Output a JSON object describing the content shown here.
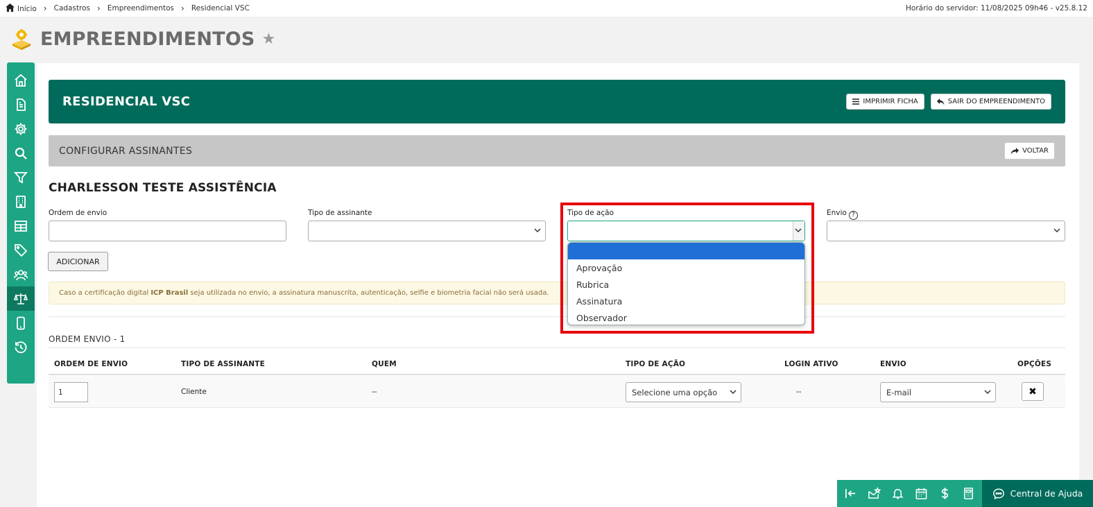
{
  "breadcrumb": {
    "items": [
      "Início",
      "Cadastros",
      "Empreendimentos",
      "Residencial VSC"
    ]
  },
  "server_info": "Horário do servidor: 11/08/2025 09h46 - v25.8.12",
  "page": {
    "title": "EMPREENDIMENTOS"
  },
  "sidebar": {
    "icons": [
      "home-icon",
      "document-icon",
      "gear-icon",
      "search-icon",
      "filter-icon",
      "building-icon",
      "table-icon",
      "tag-icon",
      "users-icon",
      "scale-icon",
      "phone-icon",
      "history-icon"
    ],
    "active_index": 9
  },
  "banner": {
    "title": "RESIDENCIAL VSC",
    "print_label": "IMPRIMIR FICHA",
    "exit_label": "SAIR DO EMPREENDIMENTO"
  },
  "subbar": {
    "title": "CONFIGURAR ASSINANTES",
    "back_label": "VOLTAR"
  },
  "section": {
    "title": "CHARLESSON TESTE ASSISTÊNCIA"
  },
  "form": {
    "ordem_label": "Ordem de envio",
    "tipo_assinante_label": "Tipo de assinante",
    "tipo_acao_label": "Tipo de ação",
    "envio_label": "Envio",
    "add_label": "ADICIONAR"
  },
  "notice": {
    "before": "Caso a certificação digital",
    "bold": "ICP Brasil",
    "after": "seja utilizada no envio, a assinatura manuscrita, autenticação, selfie e biometria facial não será usada."
  },
  "dropdown": {
    "options": [
      "",
      "Aprovação",
      "Rubrica",
      "Assinatura",
      "Observador"
    ],
    "selected_index": 0
  },
  "order": {
    "title": "ORDEM ENVIO - 1",
    "headers": [
      "ORDEM DE ENVIO",
      "TIPO DE ASSINANTE",
      "QUEM",
      "TIPO DE AÇÃO",
      "LOGIN ATIVO",
      "ENVIO",
      "OPÇÕES"
    ],
    "row": {
      "ordem": "1",
      "tipo_assinante": "Cliente",
      "quem": "--",
      "tipo_acao": "Selecione uma opção",
      "login_ativo": "--",
      "envio": "E-mail",
      "delete_glyph": "✖"
    }
  },
  "footer": {
    "help_label": "Central de Ajuda"
  },
  "colors": {
    "brand_dark": "#006b5a",
    "brand_light": "#1ea583",
    "highlight": "#e8000b",
    "selected_option": "#1f6fd6"
  }
}
